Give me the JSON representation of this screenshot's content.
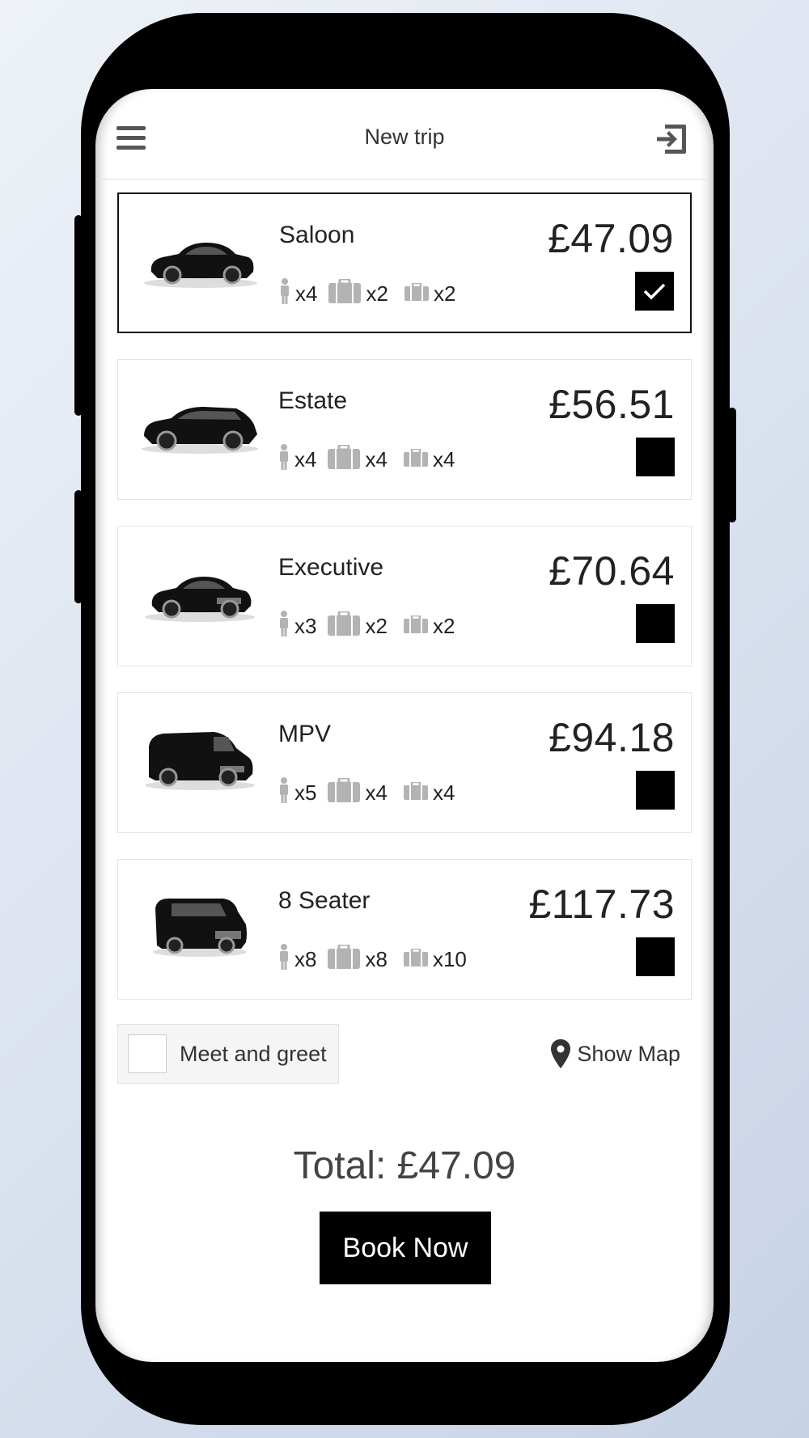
{
  "header": {
    "title": "New trip",
    "menu_icon": "hamburger-menu-icon",
    "exit_icon": "sign-in-exit-icon"
  },
  "vehicles": [
    {
      "name": "Saloon",
      "price": "£47.09",
      "passengers": "x4",
      "large_bags": "x2",
      "small_bags": "x2",
      "selected": true
    },
    {
      "name": "Estate",
      "price": "£56.51",
      "passengers": "x4",
      "large_bags": "x4",
      "small_bags": "x4",
      "selected": false
    },
    {
      "name": "Executive",
      "price": "£70.64",
      "passengers": "x3",
      "large_bags": "x2",
      "small_bags": "x2",
      "selected": false
    },
    {
      "name": "MPV",
      "price": "£94.18",
      "passengers": "x5",
      "large_bags": "x4",
      "small_bags": "x4",
      "selected": false
    },
    {
      "name": "8 Seater",
      "price": "£117.73",
      "passengers": "x8",
      "large_bags": "x8",
      "small_bags": "x10",
      "selected": false
    }
  ],
  "options": {
    "meet_and_greet_label": "Meet and greet",
    "meet_and_greet_checked": false,
    "show_map_label": "Show Map",
    "show_map_icon": "map-pin-icon"
  },
  "total": "Total: £47.09",
  "book_label": "Book Now",
  "colors": {
    "accent": "#000000",
    "text": "#222222",
    "icon_grey": "#b3b3b3"
  }
}
